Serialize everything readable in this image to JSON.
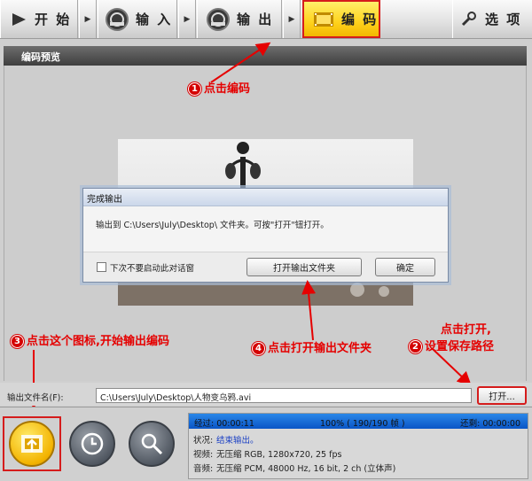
{
  "toolbar": {
    "start": "开 始",
    "input": "输 入",
    "output": "输 出",
    "encode": "编 码",
    "options": "选 项"
  },
  "preview": {
    "title": "编码预览"
  },
  "dialog": {
    "title": "完成输出",
    "message": "输出到 C:\\Users\\July\\Desktop\\ 文件夹。可按\"打开\"钮打开。",
    "checkbox_label": "下次不要启动此对话窗",
    "open_folder_button": "打开输出文件夹",
    "ok_button": "确定"
  },
  "annotations": {
    "a1": {
      "num": "1",
      "text": "点击编码"
    },
    "a2": {
      "num": "2",
      "line1": "点击打开,",
      "line2": "设置保存路径"
    },
    "a3": {
      "num": "3",
      "text": "点击这个图标,开始输出编码"
    },
    "a4": {
      "num": "4",
      "text": "点击打开输出文件夹"
    }
  },
  "output": {
    "label": "输出文件名(F):",
    "path": "C:\\Users\\July\\Desktop\\人物变乌鸦.avi",
    "open_button": "打开..."
  },
  "status": {
    "elapsed": "经过: 00:00:11",
    "progress": "100% ( 190/190 帧 )",
    "progress_fraction": 1.0,
    "remaining": "还剩: 00:00:00",
    "state_label": "状况:",
    "state_value": "结束输出。",
    "video_label": "视频:",
    "video_value": "无压缩 RGB, 1280x720, 25 fps",
    "audio_label": "音频:",
    "audio_value": "无压缩 PCM, 48000 Hz, 16 bit, 2 ch (立体声)"
  },
  "colors": {
    "accent": "#ffd21c",
    "annotation_red": "#e50000",
    "progress_blue": "#1a6fd8"
  }
}
